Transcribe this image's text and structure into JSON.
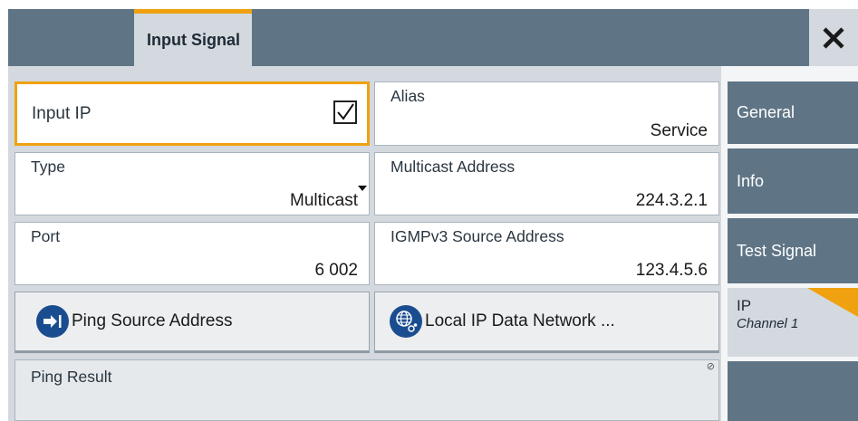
{
  "header": {
    "active_tab": "Input Signal"
  },
  "fields": {
    "input_ip": {
      "label": "Input IP",
      "checked": true
    },
    "alias": {
      "label": "Alias",
      "value": "Service"
    },
    "type": {
      "label": "Type",
      "value": "Multicast"
    },
    "multicast_address": {
      "label": "Multicast Address",
      "value": "224.3.2.1"
    },
    "port": {
      "label": "Port",
      "value": "6 002"
    },
    "igmp_source": {
      "label": "IGMPv3 Source Address",
      "value": "123.4.5.6"
    }
  },
  "buttons": {
    "ping_source": {
      "label": "Ping Source Address",
      "icon": "arrow-right-bar-icon"
    },
    "local_ip": {
      "label": "Local IP Data Network ...",
      "icon": "network-globe-icon"
    }
  },
  "ping_result": {
    "label": "Ping Result"
  },
  "side_nav": {
    "items": [
      {
        "label": "General"
      },
      {
        "label": "Info"
      },
      {
        "label": "Test Signal"
      },
      {
        "label": "IP",
        "sublabel": "Channel 1",
        "active": true
      }
    ]
  },
  "colors": {
    "header_bg": "#5f7586",
    "accent": "#f0a10f",
    "panel_bg": "#d3d9de",
    "icon_blue": "#1a4d8f"
  }
}
